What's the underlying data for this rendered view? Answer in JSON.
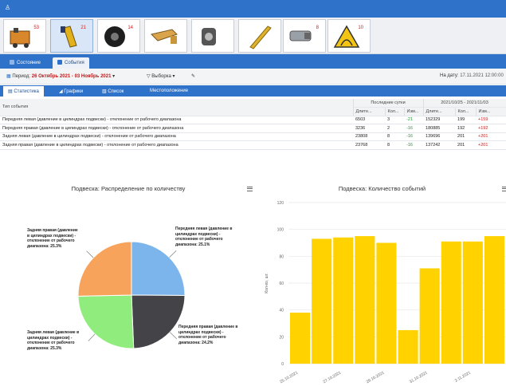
{
  "window": {
    "icon": "app-icon"
  },
  "tiles": [
    {
      "icon": "generator-icon",
      "count": "53"
    },
    {
      "icon": "plug-icon",
      "count": "21"
    },
    {
      "icon": "tire-icon",
      "count": "14"
    },
    {
      "icon": "lever-icon",
      "count": ""
    },
    {
      "icon": "engine-part-icon",
      "count": ""
    },
    {
      "icon": "rod-icon",
      "count": ""
    },
    {
      "icon": "cylinder-icon",
      "count": "8"
    },
    {
      "icon": "warning-road-icon",
      "count": "10"
    }
  ],
  "main_tabs": [
    {
      "label": "Состояние",
      "active": false
    },
    {
      "label": "События",
      "active": true
    }
  ],
  "filters": {
    "period_label": "Период:",
    "period_value": "26 Октябрь 2021 - 03 Ноябрь 2021",
    "selection_label": "Выборка",
    "date_label": "На дату:",
    "date_value": "17.11.2021 12:00:00"
  },
  "sub_tabs": [
    {
      "label": "Статистика",
      "active": true
    },
    {
      "label": "Графики",
      "active": false
    },
    {
      "label": "Список",
      "active": false
    },
    {
      "label": "Местоположение",
      "active": false
    }
  ],
  "table": {
    "col_event": "Тип события",
    "group1": "Последние сутки",
    "group2": "2021/10/25 - 2021/11/03",
    "sub": [
      "Длите...",
      "Кол...",
      "Изм...",
      "Длите...",
      "Кол...",
      "Изм..."
    ],
    "rows": [
      {
        "name": "Передняя левая (давление в цилиндрах подвески) - отклонение от рабочего диапазона",
        "d1": "6503",
        "c1": "3",
        "m1": "-21",
        "d2": "152329",
        "c2": "199",
        "m2": "+159"
      },
      {
        "name": "Передняя правая (давление в цилиндрах подвески) - отклонение от рабочего диапазона",
        "d1": "3236",
        "c1": "2",
        "m1": "-16",
        "d2": "180885",
        "c2": "192",
        "m2": "+192"
      },
      {
        "name": "Задняя левая (давление в цилиндрах подвески) - отклонение от рабочего диапазона",
        "d1": "23808",
        "c1": "8",
        "m1": "-16",
        "d2": "139696",
        "c2": "201",
        "m2": "+201"
      },
      {
        "name": "Задняя правая (давление в цилиндрах подвески) - отклонение от рабочего диапазона",
        "d1": "23768",
        "c1": "8",
        "m1": "-16",
        "d2": "137242",
        "c2": "201",
        "m2": "+201"
      }
    ]
  },
  "chart_data": [
    {
      "type": "pie",
      "title": "Подвеска: Распределение по количеству",
      "slices": [
        {
          "label": "Передняя левая (давление в цилиндрах подвески) - отклонение от рабочего диапазона: 25.1%",
          "value": 25.1,
          "color": "#7cb5ec"
        },
        {
          "label": "Передняя правая (давление в цилиндрах подвески) - отклонение от рабочего диапазона: 24.2%",
          "value": 24.2,
          "color": "#434348"
        },
        {
          "label": "Задняя левая (давление в цилиндрах подвески) - отклонение от рабочего диапазона: 25.3%",
          "value": 25.3,
          "color": "#90ed7d"
        },
        {
          "label": "Задняя правая (давление в цилиндрах подвески) - отклонение от рабочего диапазона: 25.3%",
          "value": 25.3,
          "color": "#f7a35c"
        }
      ]
    },
    {
      "type": "bar",
      "title": "Подвеска: Количество событий",
      "ylabel": "Кол-во, шт.",
      "ylim": [
        0,
        120
      ],
      "yticks": [
        0,
        20,
        40,
        60,
        80,
        100,
        120
      ],
      "color": "#ffd200",
      "values": [
        38,
        93,
        94,
        95,
        90,
        25,
        71,
        91,
        91,
        95
      ],
      "xtick_labels": [
        "25.10.2021",
        "27.10.2021",
        "29.10.2021",
        "31.10.2021",
        "2.11.2021"
      ],
      "grid": true
    }
  ]
}
